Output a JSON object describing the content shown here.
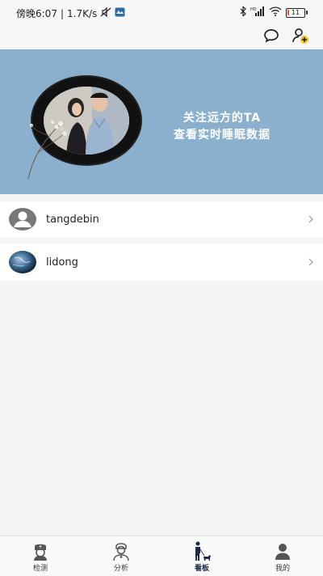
{
  "status_bar": {
    "time": "傍晚6:07",
    "speed": "1.7K/s",
    "battery": "11",
    "battery_level": 0.11
  },
  "banner": {
    "line1": "关注远方的TA",
    "line2": "查看实时睡眠数据",
    "background_color": "#8ab0cd"
  },
  "list": [
    {
      "name": "tangdebin",
      "avatar": "default-avatar-icon"
    },
    {
      "name": "lidong",
      "avatar": "earth-avatar"
    }
  ],
  "nav": {
    "items": [
      {
        "label": "检测",
        "icon": "nurse-icon"
      },
      {
        "label": "分析",
        "icon": "doctor-icon"
      },
      {
        "label": "看板",
        "icon": "person-dog-icon",
        "active": true
      },
      {
        "label": "我的",
        "icon": "user-icon"
      }
    ]
  }
}
